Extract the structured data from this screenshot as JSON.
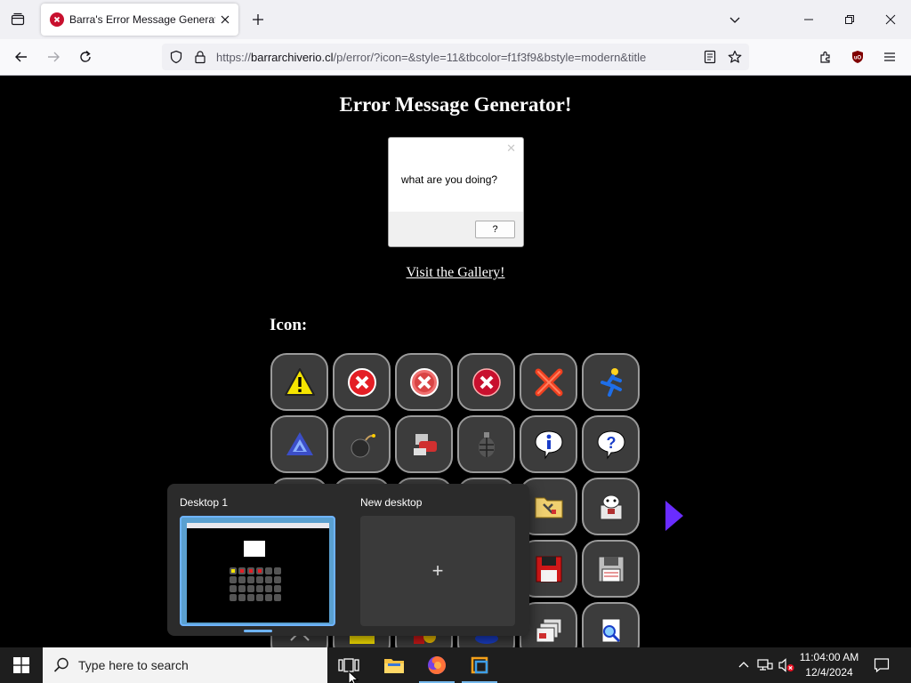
{
  "browser": {
    "tab_title": "Barra's Error Message Generator",
    "url_prefix": "https://",
    "url_host": "barrarchiverio.cl",
    "url_path": "/p/error/?icon=&style=11&tbcolor=f1f3f9&bstyle=modern&title"
  },
  "page": {
    "title": "Error Message Generator!",
    "dialog": {
      "message": "what are you doing?",
      "button_label": "?"
    },
    "gallery_link": "Visit the Gallery!",
    "icon_heading": "Icon:",
    "icons": [
      "warning-icon",
      "error-x-icon",
      "error-x-faded-icon",
      "error-x-dark-icon",
      "red-x-icon",
      "running-man-icon",
      "aim-triangle-icon",
      "bomb-icon",
      "robot-hand-icon",
      "grenade-icon",
      "info-bubble-icon",
      "question-bubble-icon",
      "hidden-icon",
      "hidden-icon",
      "hidden-icon",
      "hidden-icon",
      "folder-tools-icon",
      "cow-computer-icon",
      "hidden-icon",
      "hidden-icon",
      "hidden-icon",
      "hidden-icon",
      "red-floppy-icon",
      "floppy-icon",
      "scissors-icon",
      "yellow-note-icon",
      "paint-icon",
      "blue-shape-icon",
      "stacked-windows-icon",
      "search-doc-icon"
    ]
  },
  "taskview": {
    "desktop1_label": "Desktop 1",
    "new_desktop_label": "New desktop",
    "new_desktop_plus": "+"
  },
  "taskbar": {
    "search_placeholder": "Type here to search",
    "time": "11:04:00 AM",
    "date": "12/4/2024"
  },
  "colors": {
    "accent": "#6fb4ff",
    "error_red": "#c8102e"
  }
}
